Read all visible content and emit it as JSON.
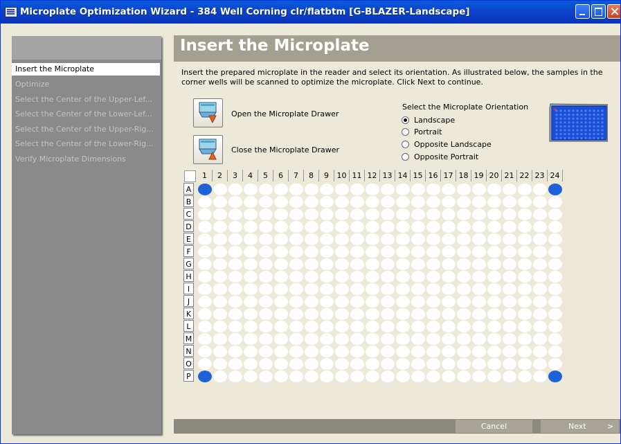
{
  "window": {
    "title": "Microplate Optimization Wizard - 384 Well Corning clr/flatbtm [G-BLAZER-Landscape]"
  },
  "sidebar": {
    "steps": [
      {
        "label": "Insert the Microplate",
        "active": true
      },
      {
        "label": "Optimize",
        "active": false
      },
      {
        "label": "Select the Center of the Upper-Lef...",
        "active": false
      },
      {
        "label": "Select the Center of the Lower-Lef...",
        "active": false
      },
      {
        "label": "Select the Center of the Upper-Rig...",
        "active": false
      },
      {
        "label": "Select the Center of the Lower-Rig...",
        "active": false
      },
      {
        "label": "Verify Microplate Dimensions",
        "active": false
      }
    ]
  },
  "main": {
    "title": "Insert the Microplate",
    "description": "Insert the prepared microplate in the reader and select its orientation. As illustrated below, the samples in the corner wells will be scanned to optimize the microplate. Click Next to continue.",
    "open_drawer_label": "Open the Microplate Drawer",
    "close_drawer_label": "Close the Microplate Drawer",
    "orientation": {
      "title": "Select the Microplate Orientation",
      "options": [
        "Landscape",
        "Portrait",
        "Opposite Landscape",
        "Opposite Portrait"
      ],
      "selected": "Landscape"
    },
    "plate": {
      "columns": [
        "1",
        "2",
        "3",
        "4",
        "5",
        "6",
        "7",
        "8",
        "9",
        "10",
        "11",
        "12",
        "13",
        "14",
        "15",
        "16",
        "17",
        "18",
        "19",
        "20",
        "21",
        "22",
        "23",
        "24"
      ],
      "rows": [
        "A",
        "B",
        "C",
        "D",
        "E",
        "F",
        "G",
        "H",
        "I",
        "J",
        "K",
        "L",
        "M",
        "N",
        "O",
        "P"
      ],
      "highlighted_wells": [
        "A1",
        "A24",
        "P1",
        "P24"
      ]
    }
  },
  "footer": {
    "cancel_label": "Cancel",
    "next_label": "Next",
    "next_arrow": ">"
  },
  "colors": {
    "titlebar": "#0b3fc7",
    "sidebar": "#8a8a8a",
    "header_bar": "#a39f91",
    "highlight_well": "#1d63d7",
    "plate_thumbnail": "#1b4fd8"
  },
  "icons": {
    "open_drawer": "drawer-open-icon",
    "close_drawer": "drawer-close-icon",
    "window_app": "app-window-icon"
  }
}
